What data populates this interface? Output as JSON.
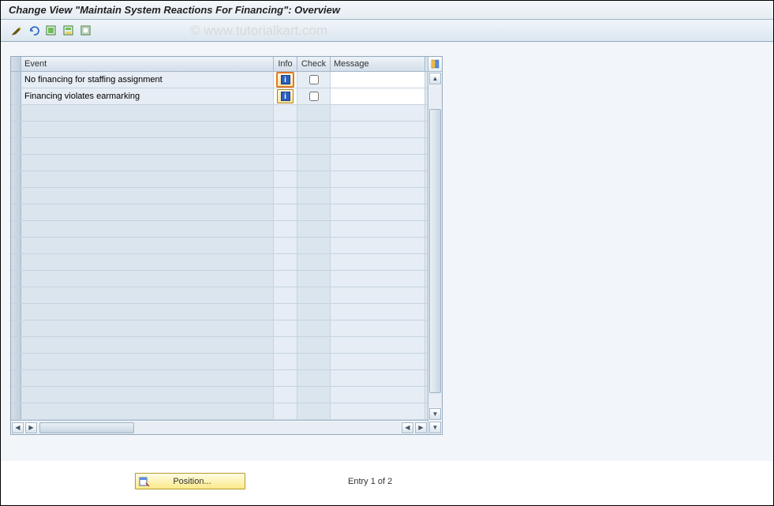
{
  "title": "Change View \"Maintain System Reactions For Financing\": Overview",
  "watermark": "© www.tutorialkart.com",
  "toolbar": {
    "icons": [
      "change-display",
      "undo",
      "select-all",
      "select-block",
      "deselect-all"
    ]
  },
  "table": {
    "columns": {
      "event": "Event",
      "info": "Info",
      "check": "Check",
      "message": "Message"
    },
    "rows": [
      {
        "event": "No financing for staffing assignment",
        "info": true,
        "check": false,
        "message": "",
        "focused": true
      },
      {
        "event": "Financing violates earmarking",
        "info": true,
        "check": false,
        "message": "",
        "focused": false
      }
    ],
    "empty_rows": 21
  },
  "footer": {
    "position_label": "Position...",
    "entry_text": "Entry 1 of 2"
  }
}
